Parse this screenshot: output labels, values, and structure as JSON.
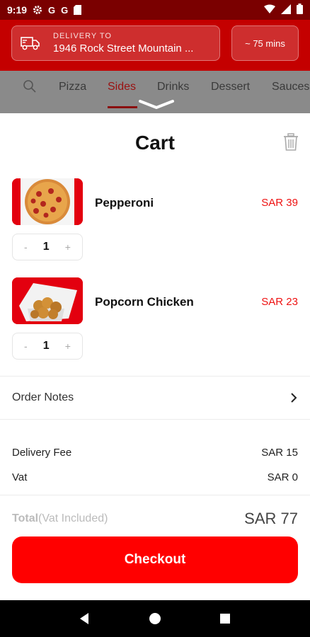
{
  "status_bar": {
    "time": "9:19",
    "icons": [
      "gear-icon",
      "google-g-icon",
      "google-g-icon",
      "sd-card-icon"
    ],
    "right_icons": [
      "wifi-icon",
      "signal-icon",
      "battery-icon"
    ]
  },
  "header": {
    "delivery_label": "DELIVERY TO",
    "delivery_address": "1946 Rock Street Mountain ...",
    "eta": "~ 75 mins"
  },
  "categories": [
    "Pizza",
    "Sides",
    "Drinks",
    "Dessert",
    "Sauces"
  ],
  "active_category": "Sides",
  "cart": {
    "title": "Cart",
    "items": [
      {
        "name": "Pepperoni",
        "price": "SAR 39",
        "quantity": "1",
        "minus": "-",
        "plus": "+"
      },
      {
        "name": "Popcorn Chicken",
        "price": "SAR 23",
        "quantity": "1",
        "minus": "-",
        "plus": "+"
      }
    ],
    "order_notes_label": "Order Notes",
    "fees": [
      {
        "label": "Delivery Fee",
        "value": "SAR 15"
      },
      {
        "label": "Vat",
        "value": "SAR 0"
      }
    ],
    "total_label": "Total",
    "total_sub": "(Vat Included)",
    "total_value": "SAR 77",
    "checkout_label": "Checkout"
  },
  "colors": {
    "brand_red": "#c40000",
    "checkout_red": "#ff0000",
    "price_red": "#e11111"
  }
}
